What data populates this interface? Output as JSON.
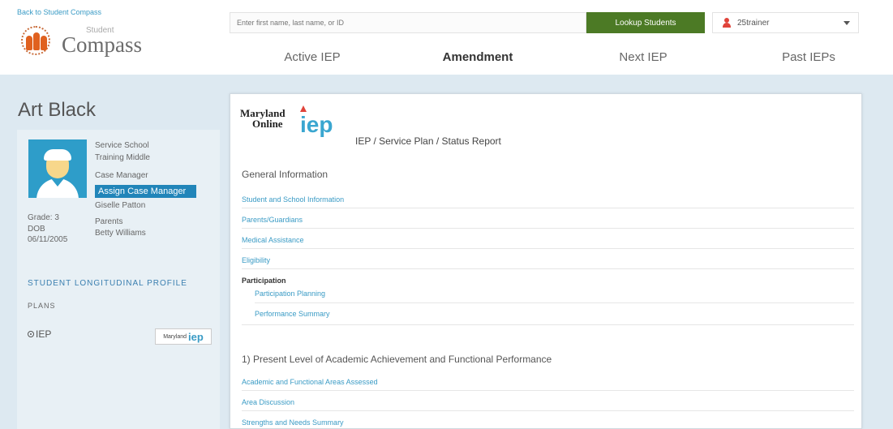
{
  "top": {
    "back_link": "Back to Student Compass",
    "logo_small": "Student",
    "logo_big": "Compass",
    "search_placeholder": "Enter first name, last name, or ID",
    "lookup_label": "Lookup Students",
    "user_name": "25trainer"
  },
  "tabs": [
    {
      "label": "Active IEP",
      "active": false
    },
    {
      "label": "Amendment",
      "active": true
    },
    {
      "label": "Next IEP",
      "active": false
    },
    {
      "label": "Past IEPs",
      "active": false
    }
  ],
  "student": {
    "name": "Art Black",
    "service_school_label": "Service School",
    "service_school": "Training Middle",
    "case_manager_label": "Case Manager",
    "assign_btn": "Assign Case Manager",
    "case_manager": "Giselle Patton",
    "parents_label": "Parents",
    "parents": "Betty Williams",
    "grade": "Grade: 3",
    "dob_label": "DOB",
    "dob": "06/11/2005",
    "longitudinal": "STUDENT LONGITUDINAL PROFILE",
    "plans": "PLANS",
    "plan_iep": "IEP",
    "small_logo_md": "Maryland",
    "small_logo_ol": "Online",
    "small_logo_iep": "iep"
  },
  "panel": {
    "logo_md": "Maryland",
    "logo_ol": "Online",
    "logo_iep": "iep",
    "title": "IEP / Service Plan / Status Report",
    "general_info": "General Information",
    "links_general": [
      "Student and School Information",
      "Parents/Guardians",
      "Medical Assistance",
      "Eligibility"
    ],
    "participation": "Participation",
    "participation_links": [
      "Participation Planning",
      "Performance Summary"
    ],
    "plaafp": "1) Present Level of Academic Achievement and Functional Performance",
    "plaafp_links": [
      "Academic and Functional Areas Assessed",
      "Area Discussion",
      "Strengths and Needs Summary"
    ]
  }
}
